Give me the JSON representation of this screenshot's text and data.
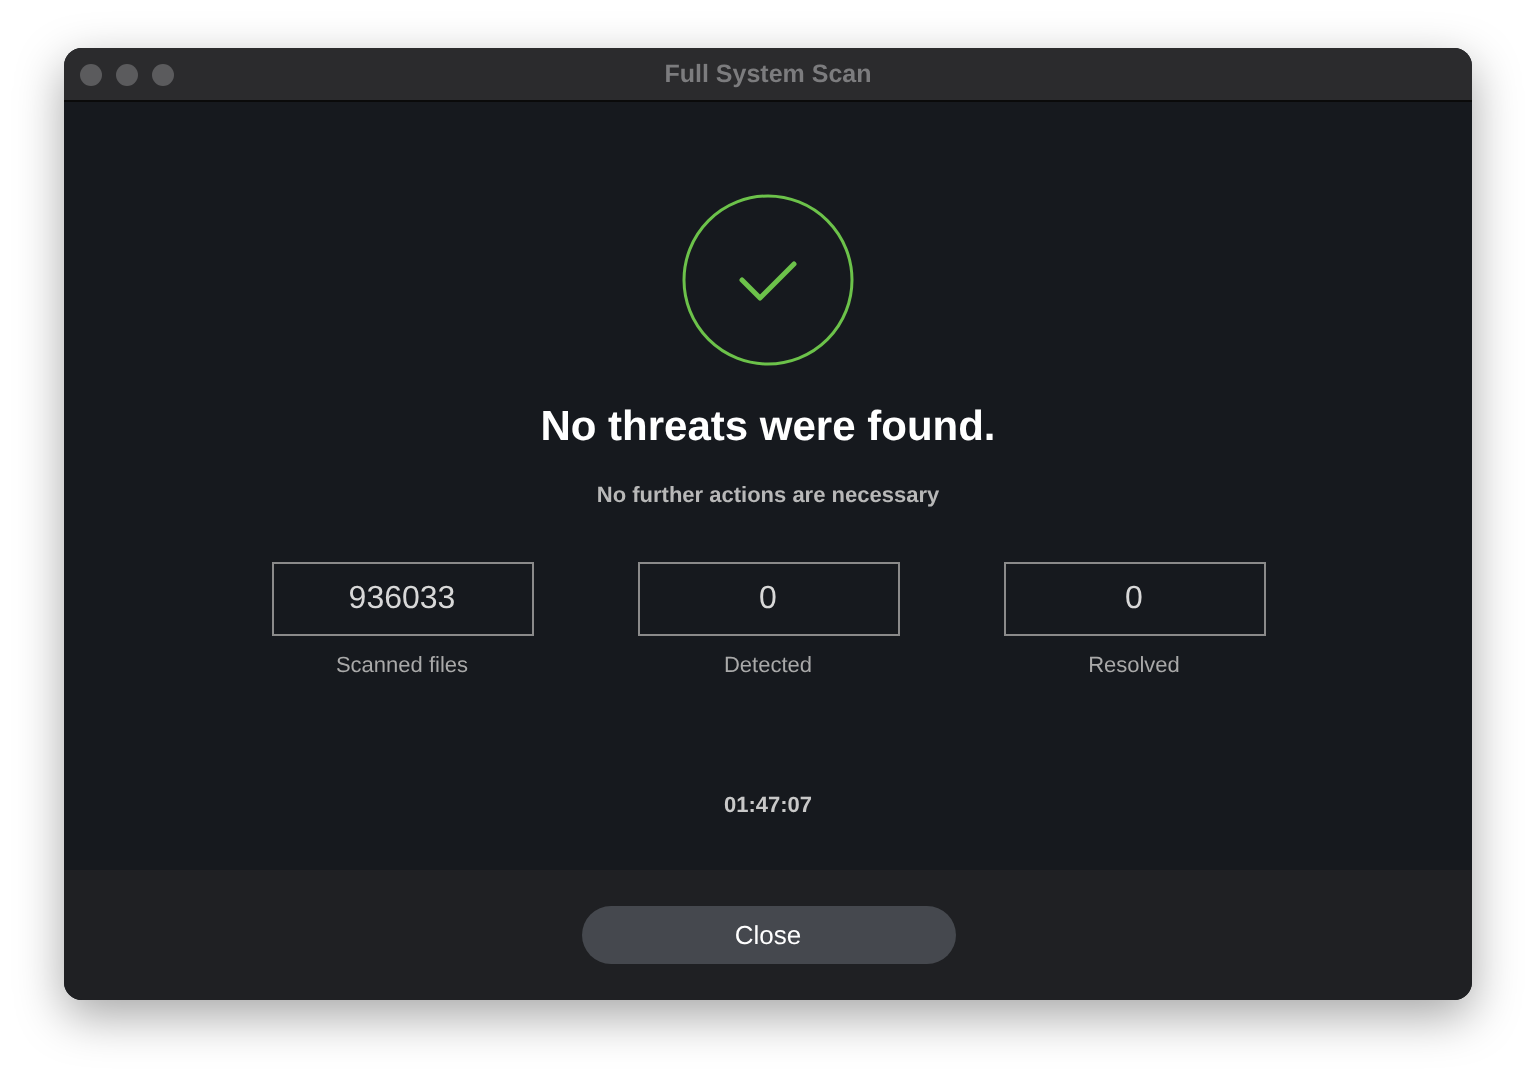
{
  "window": {
    "title": "Full System Scan"
  },
  "result": {
    "passed": true,
    "heading": "No threats were found.",
    "subtitle": "No further actions are necessary"
  },
  "stats": [
    {
      "value": "936033",
      "label": "Scanned files"
    },
    {
      "value": "0",
      "label": "Detected"
    },
    {
      "value": "0",
      "label": "Resolved"
    }
  ],
  "elapsed": "01:47:07",
  "buttons": [
    "Close"
  ]
}
